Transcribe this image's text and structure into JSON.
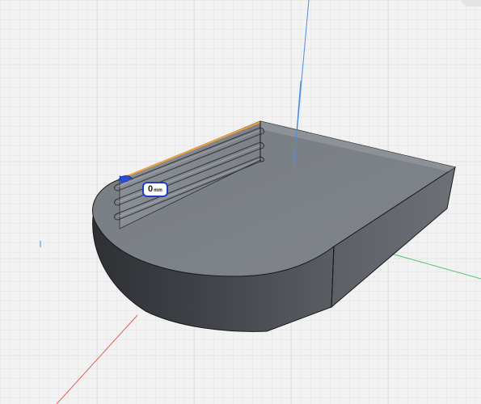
{
  "dimension_input": {
    "value": "0",
    "unit": "mm"
  },
  "colors": {
    "background": "#f2f2f3",
    "grid_line": "#d6d6d8",
    "axis_x": "#e2605a",
    "axis_y": "#58c36c",
    "axis_z": "#4a90e2",
    "body_top": "#7b8086",
    "body_side_dark": "#3c3f44",
    "selected_edge": "#e8a040",
    "dimension_accent": "#1e3cc8"
  },
  "icons": {
    "dimension_handle": "arrow-handle-icon"
  }
}
